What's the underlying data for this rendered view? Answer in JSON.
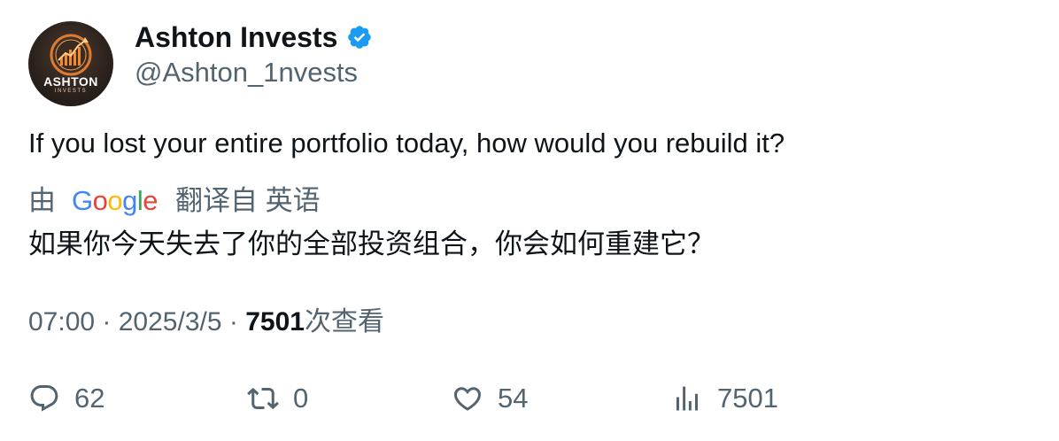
{
  "author": {
    "display_name": "Ashton Invests",
    "handle": "@Ashton_1nvests",
    "avatar_brand": "ASHTON",
    "avatar_brand_sub": "INVESTS",
    "verified_color": "#1d9bf0"
  },
  "tweet": {
    "text": "If you lost your entire portfolio today, how would you rebuild it?"
  },
  "translation": {
    "prefix": "由",
    "provider": "Google",
    "suffix": "翻译自 英语",
    "text": "如果你今天失去了你的全部投资组合，你会如何重建它？"
  },
  "meta": {
    "time": "07:00",
    "separator": " · ",
    "date": "2025/3/5",
    "views_count": "7501",
    "views_label": "次查看"
  },
  "actions": {
    "reply_count": "62",
    "retweet_count": "0",
    "like_count": "54",
    "views_count": "7501"
  },
  "colors": {
    "text_primary": "#0f1419",
    "text_secondary": "#536471"
  }
}
